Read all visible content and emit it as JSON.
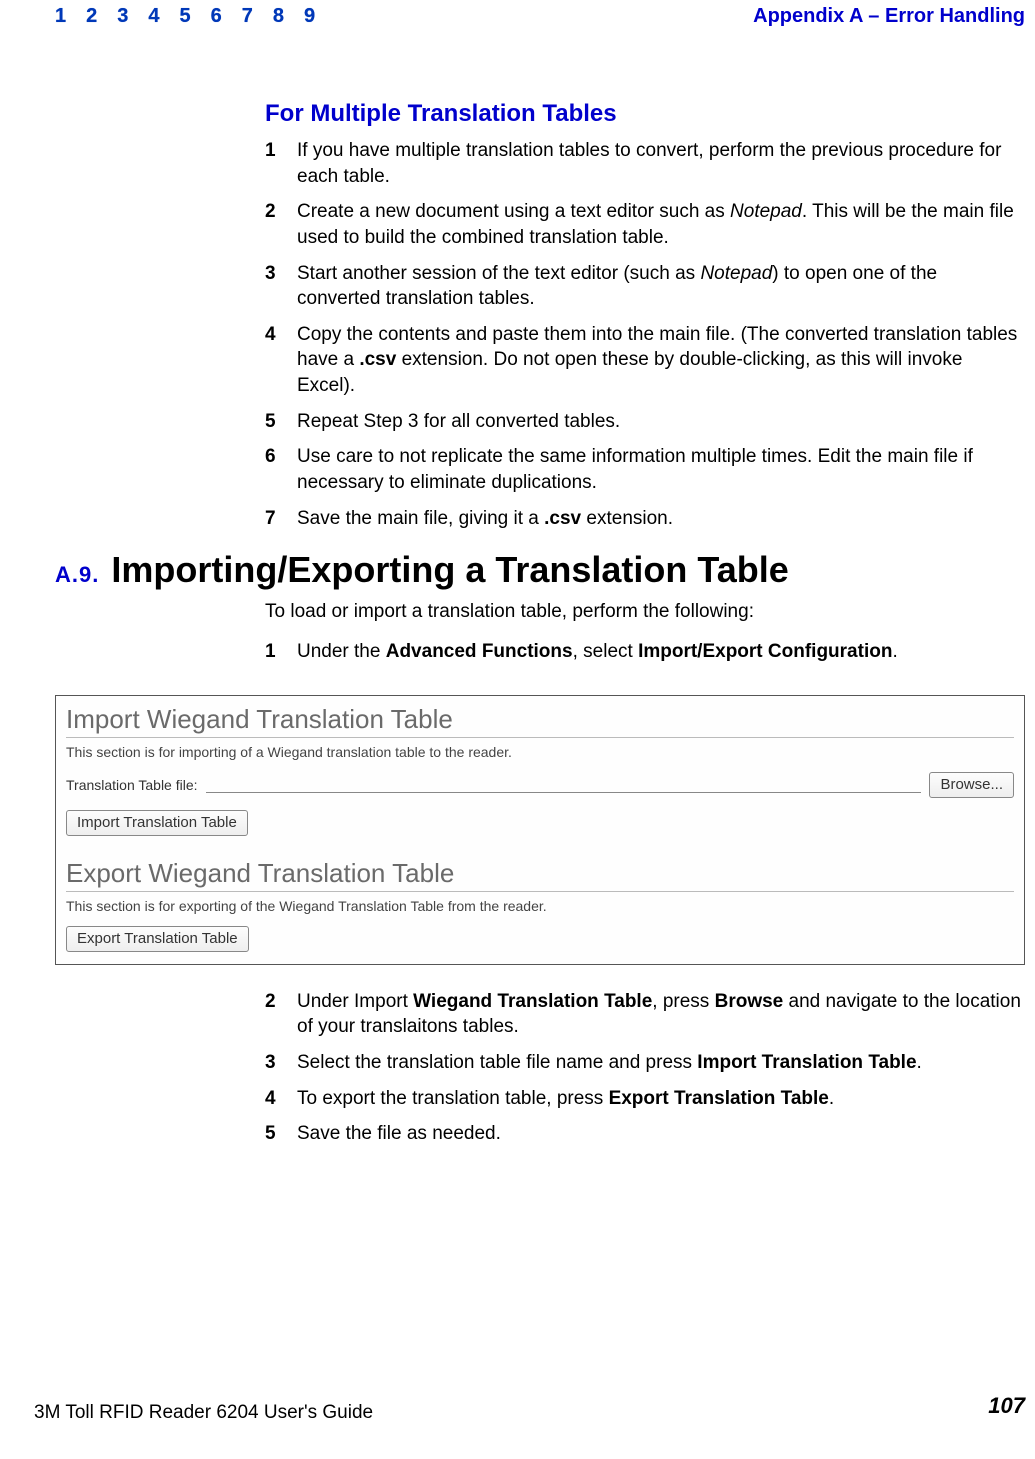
{
  "header": {
    "nav": [
      "1",
      "2",
      "3",
      "4",
      "5",
      "6",
      "7",
      "8",
      "9"
    ],
    "appendix": "Appendix A – Error Handling"
  },
  "h_mult": "For Multiple Translation Tables",
  "list_mult": [
    {
      "n": "1",
      "t_pre": "If you have multiple translation tables to convert, perform the previous procedure for each table."
    },
    {
      "n": "2",
      "t_pre": "Create a new document using a text editor such as ",
      "em1": "Notepad",
      "t_post": ". This will be the main file used to build the combined translation table."
    },
    {
      "n": "3",
      "t_pre": "Start another session of the text editor (such as ",
      "em1": "Notepad",
      "t_post": ") to open one of the converted translation tables."
    },
    {
      "n": "4",
      "t_pre": "Copy the contents and paste them into the main file. (The converted translation tables have a ",
      "b1": ".csv",
      "t_post": " extension. Do not open these by double-clicking, as this will invoke Excel)."
    },
    {
      "n": "5",
      "t_pre": "Repeat Step 3 for all converted tables."
    },
    {
      "n": "6",
      "t_pre": "Use care to not replicate the same information multiple times. Edit the main file if necessary to eliminate duplications."
    },
    {
      "n": "7",
      "t_pre": "Save the main file, giving it a ",
      "b1": ".csv",
      "t_post": " extension."
    }
  ],
  "sec": {
    "num": "A.9.",
    "title": "Importing/Exporting a Translation Table"
  },
  "intro_para": "To load or import a translation table, perform the following:",
  "list_pre": [
    {
      "n": "1",
      "pre": "Under the ",
      "b1": "Advanced Functions",
      "mid": ", select ",
      "b2": "Import/Export Configuration",
      "post": "."
    }
  ],
  "screenshot": {
    "import_title": "Import Wiegand Translation Table",
    "import_desc": "This section is for importing of a Wiegand translation table to the reader.",
    "file_label": "Translation Table file:",
    "browse_btn": "Browse...",
    "import_btn": "Import Translation Table",
    "export_title": "Export Wiegand Translation Table",
    "export_desc": "This section is for exporting of the Wiegand Translation Table from the reader.",
    "export_btn": "Export Translation Table"
  },
  "list_post": [
    {
      "n": "2",
      "pre": "Under Import ",
      "b1": "Wiegand Translation Table",
      "mid": ", press ",
      "b2": "Browse",
      "post": " and navigate to the location of your translaitons tables."
    },
    {
      "n": "3",
      "pre": "Select the translation table file name and press ",
      "b1": "Import Translation Table",
      "post": "."
    },
    {
      "n": "4",
      "pre": "To export the translation table, press ",
      "b1": "Export Translation Table",
      "post": "."
    },
    {
      "n": "5",
      "pre": "Save the file as needed."
    }
  ],
  "footer": {
    "left": "3M Toll RFID Reader 6204 User's Guide",
    "right": "107"
  }
}
